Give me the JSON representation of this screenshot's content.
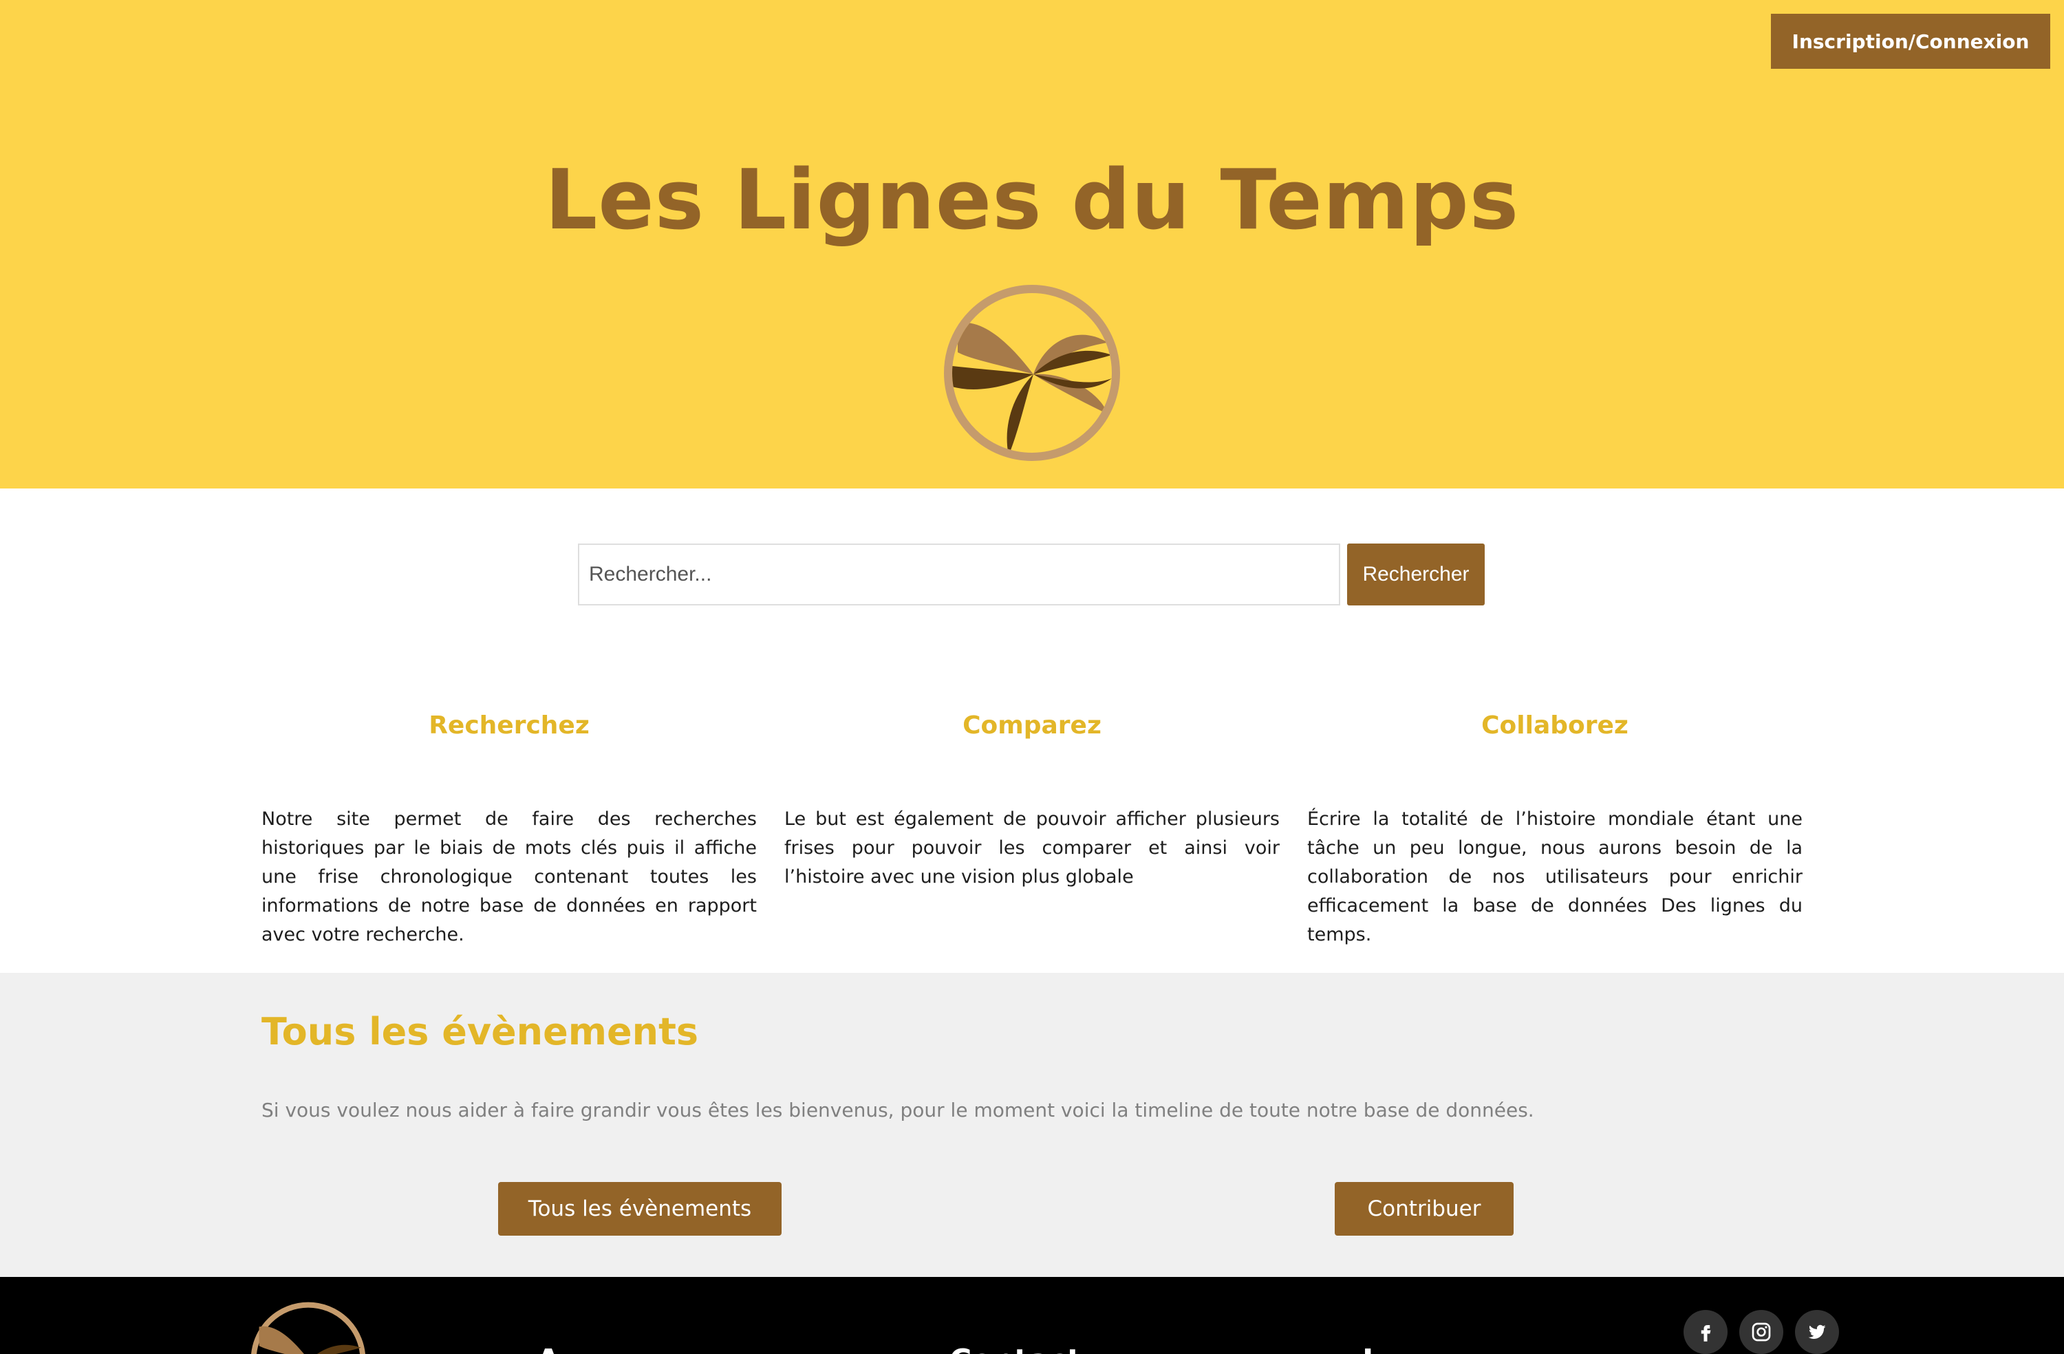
{
  "header": {
    "login_label": "Inscription/Connexion",
    "site_title": "Les Lignes du Temps",
    "logo_icon": "timeline-logo-icon"
  },
  "search": {
    "placeholder": "Rechercher...",
    "button_label": "Rechercher"
  },
  "features": [
    {
      "title": "Recherchez",
      "text": "Notre site permet de faire des recherches historiques par le biais de mots clés puis il affiche une frise chronologique contenant toutes les informations de notre base de données en rapport avec votre recherche."
    },
    {
      "title": "Comparez",
      "text": "Le but est également de pouvoir afficher plusieurs frises pour pouvoir les comparer et ainsi voir l’histoire avec une vision plus globale"
    },
    {
      "title": "Collaborez",
      "text": "Écrire la totalité de l’histoire mondiale étant une tâche un peu longue, nous aurons besoin de la collaboration de nos utilisateurs pour enrichir efficacement la base de données Des lignes du temps."
    }
  ],
  "events": {
    "title": "Tous les évènements",
    "text": "Si vous voulez nous aider à faire grandir vous êtes les bienvenus, pour le moment voici la timeline de toute notre base de données.",
    "all_events_label": "Tous les évènements",
    "contribute_label": "Contribuer"
  },
  "footer": {
    "columns": [
      "A",
      "Contact",
      "L"
    ],
    "social_icons": [
      "facebook-icon",
      "instagram-icon",
      "twitter-icon"
    ]
  },
  "colors": {
    "header_bg": "#fdd44a",
    "brand_brown": "#936428",
    "accent_gold": "#e3b628",
    "events_bg": "#f0f0f0",
    "footer_bg": "#000000"
  }
}
